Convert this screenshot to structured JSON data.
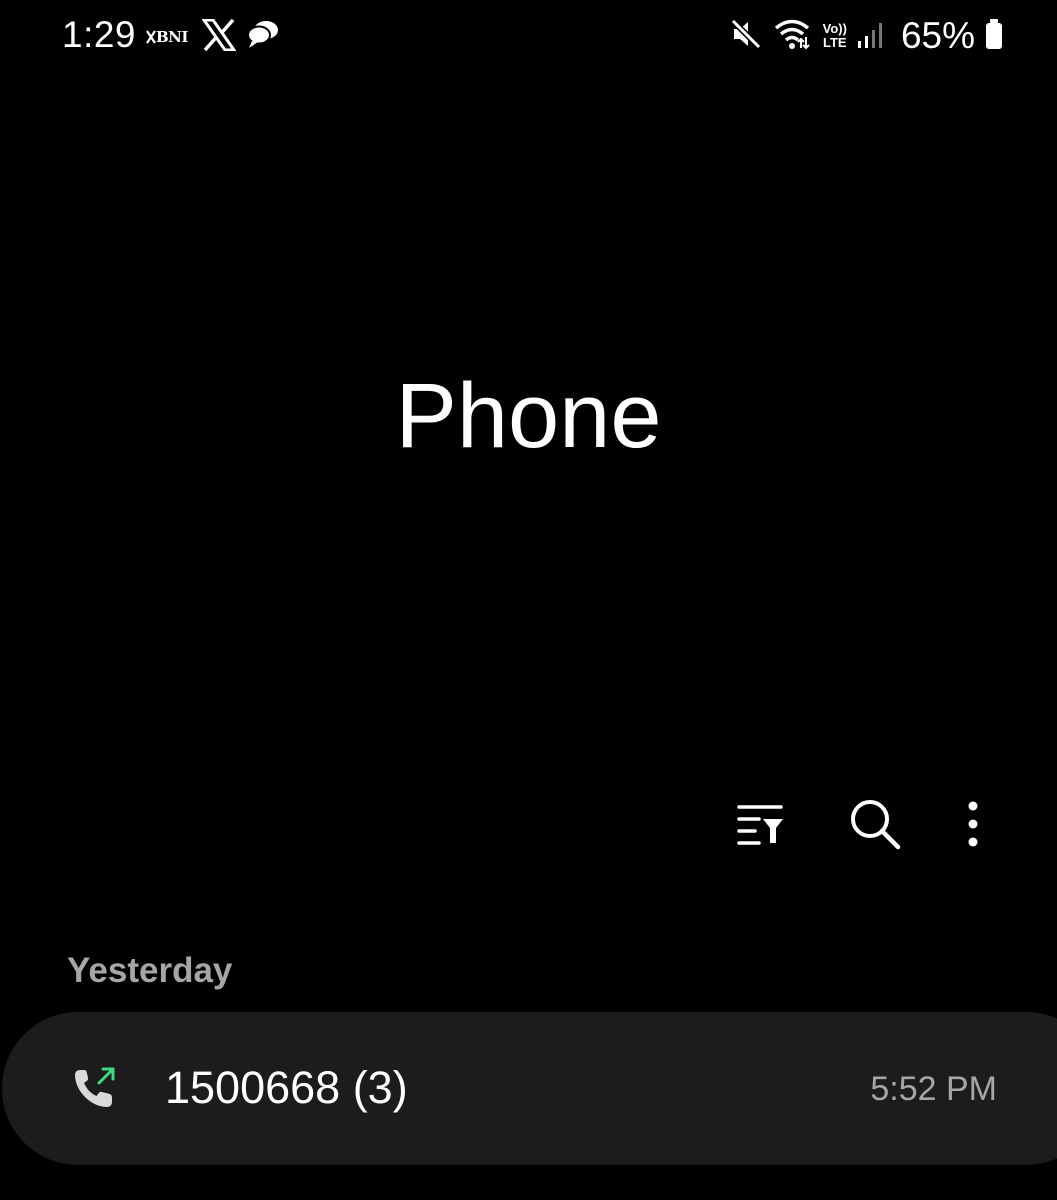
{
  "status_bar": {
    "time": "1:29",
    "bank_label": "BNI",
    "network_top": "Vo))",
    "network_bottom": "LTE",
    "battery": "65%",
    "icons": [
      "bni-icon",
      "x-icon",
      "chat-bubble-icon",
      "mute-icon",
      "wifi-icon",
      "volte-icon",
      "signal-icon",
      "battery-icon"
    ]
  },
  "header": {
    "title": "Phone"
  },
  "toolbar": {
    "icons": [
      "filter-icon",
      "search-icon",
      "more-options-icon"
    ]
  },
  "call_log": {
    "sections": [
      {
        "label": "Yesterday",
        "items": [
          {
            "type_icon": "outgoing-call-icon",
            "name": "1500668 (3)",
            "time": "5:52 PM"
          }
        ]
      }
    ]
  },
  "colors": {
    "background": "#000000",
    "card": "#1c1c1e",
    "secondary_text": "#a6a6a6",
    "outgoing_arrow": "#3ddc84"
  }
}
